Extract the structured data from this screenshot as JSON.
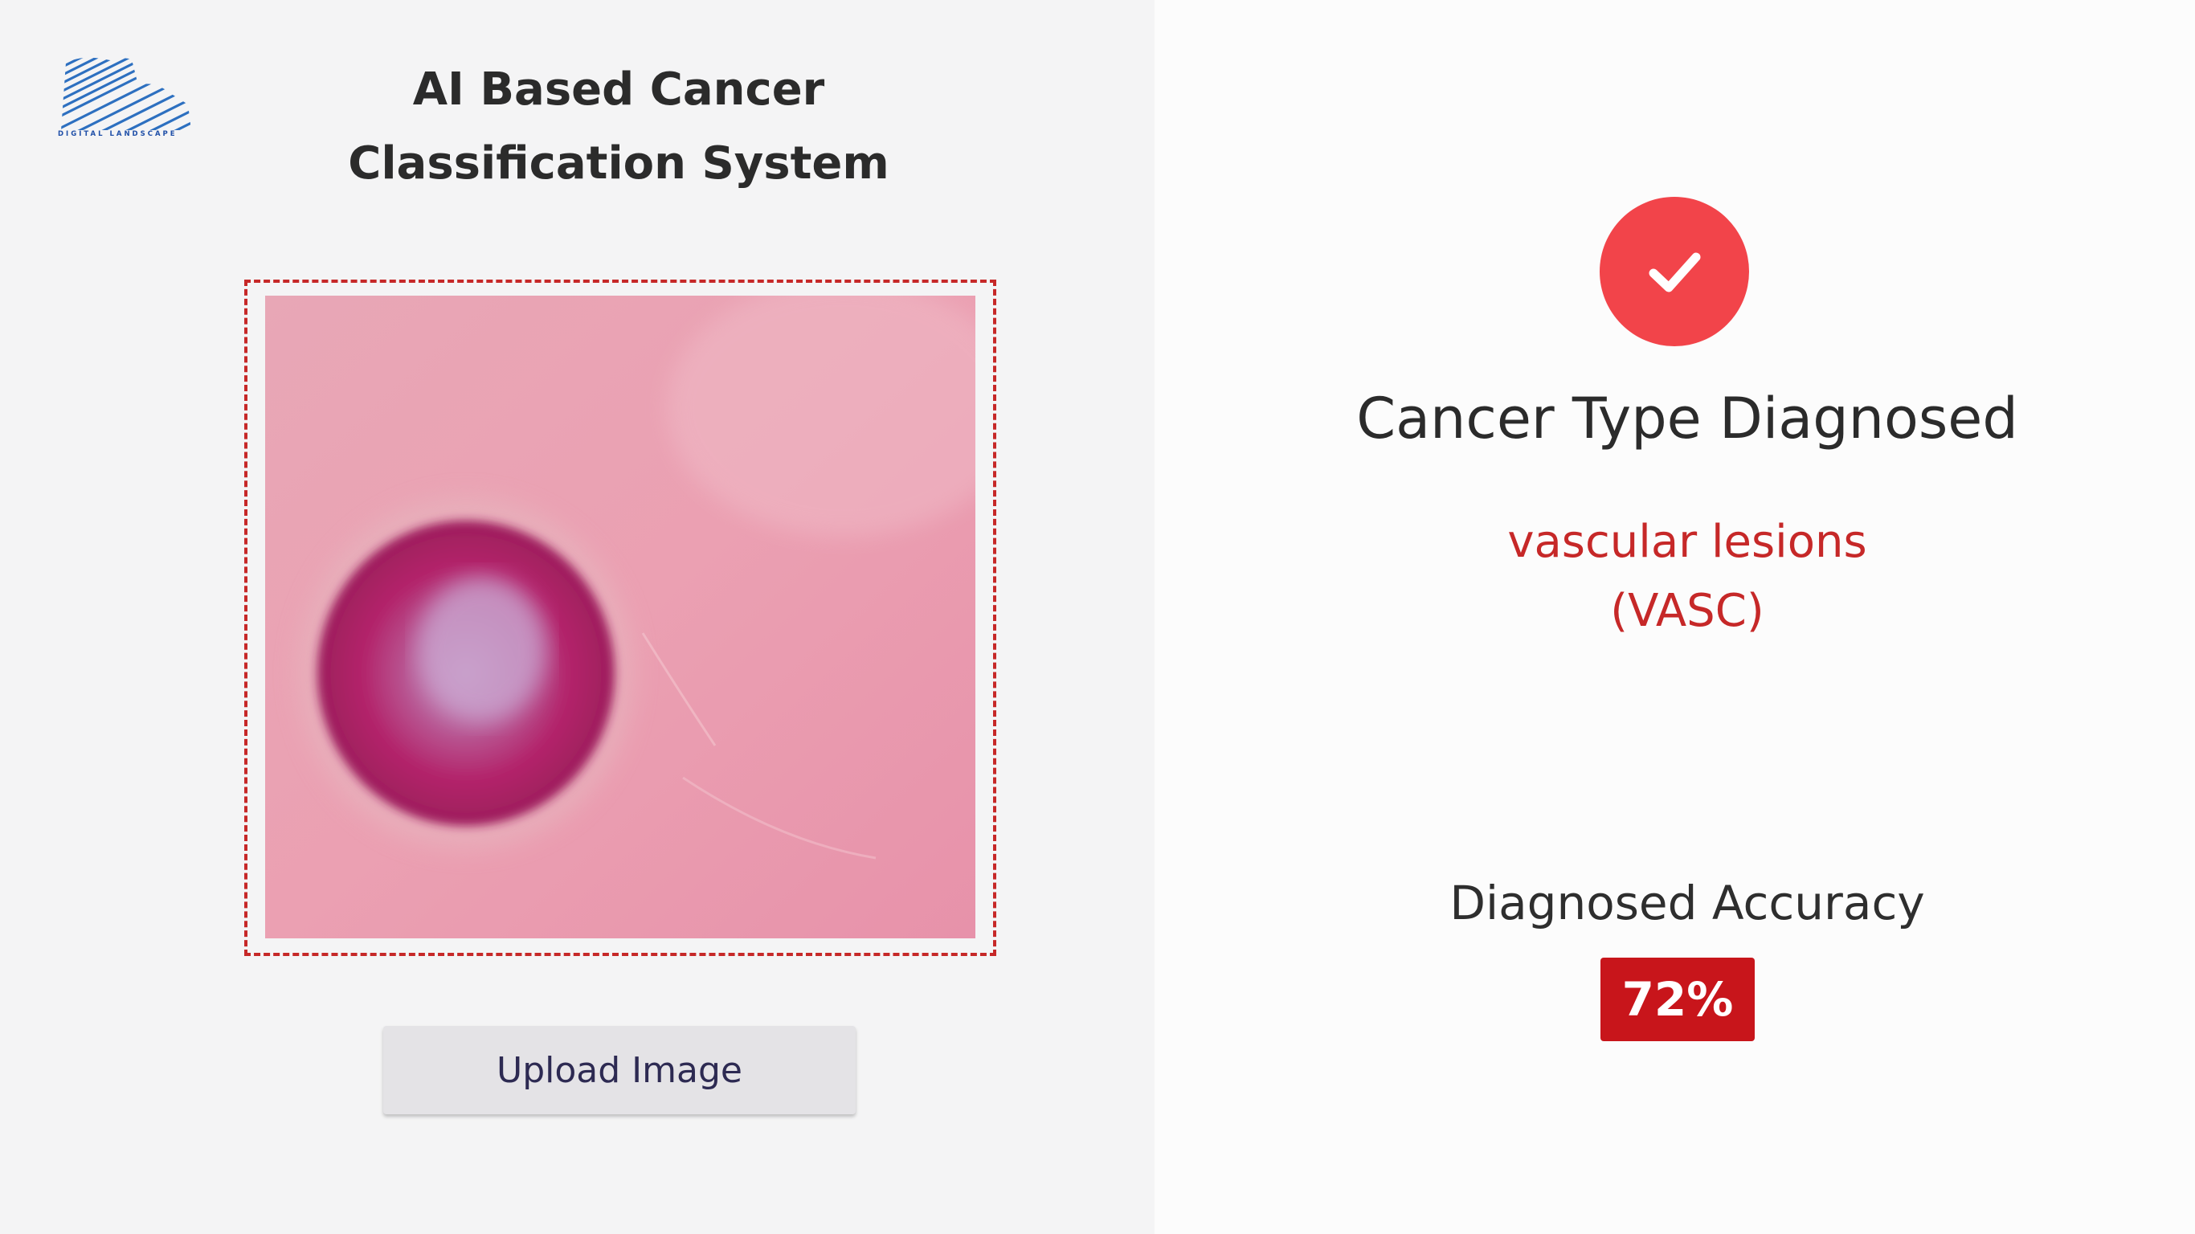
{
  "header": {
    "logo_text": "DIGITAL LANDSCAPE",
    "title_line1": "AI Based Cancer",
    "title_line2": "Classification System"
  },
  "upload": {
    "button_label": "Upload Image"
  },
  "result": {
    "status_icon": "check-icon",
    "heading": "Cancer Type Diagnosed",
    "type_name": "vascular lesions",
    "type_code": "(VASC)",
    "accuracy_label": "Diagnosed Accuracy",
    "accuracy_value": "72%"
  },
  "colors": {
    "accent": "#c62828",
    "success_circle": "#f2444a",
    "badge": "#c8151b",
    "logo_blue": "#1f4fa8"
  }
}
